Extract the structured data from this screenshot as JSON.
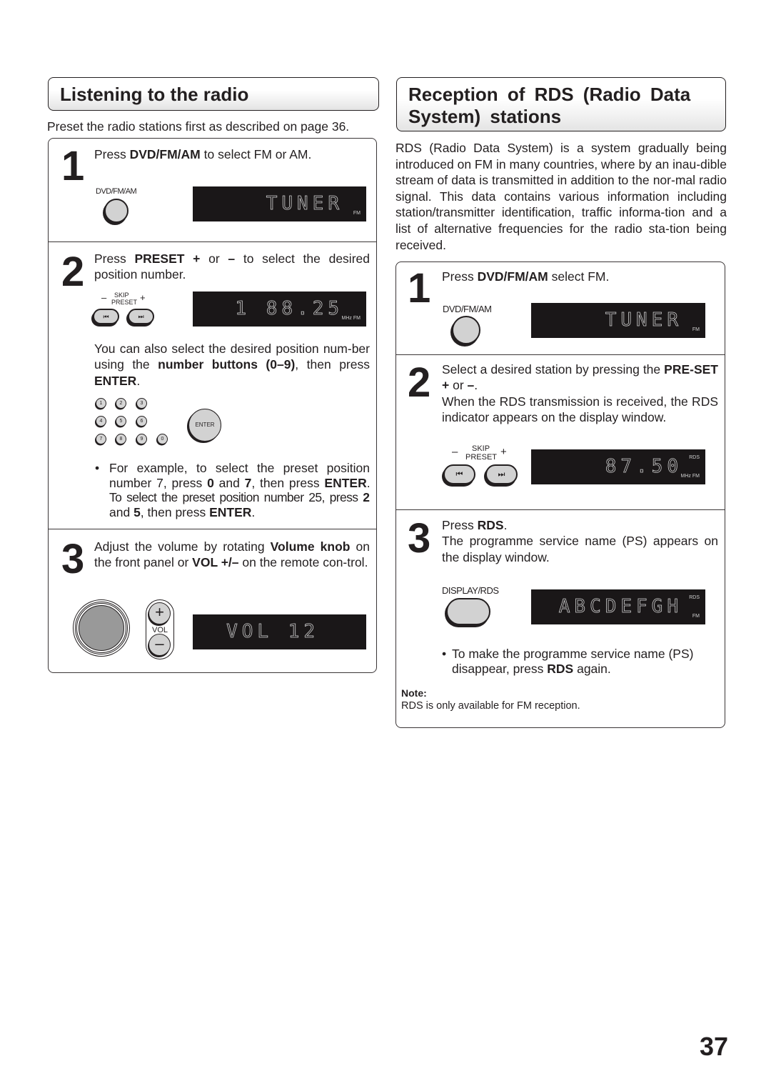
{
  "left_section": {
    "title": "Listening to the radio",
    "intro": "Preset the radio stations first as described on page 36.",
    "step1": {
      "number": "1",
      "text_pre": "Press ",
      "text_bold": "DVD/FM/AM",
      "text_post": " to select FM or AM.",
      "button_label": "DVD/FM/AM",
      "display": {
        "main": "TUNER",
        "indicator": "FM"
      }
    },
    "step2": {
      "number": "2",
      "text_pre": "Press ",
      "text_bold1": "PRESET +",
      "text_mid": " or ",
      "text_bold2": "–",
      "text_post": "  to select the desired position number.",
      "skip_label": "SKIP",
      "preset_label": "PRESET",
      "minus_label": "–",
      "plus_label": "+",
      "prev_glyph": "⏮",
      "next_glyph": "⏭",
      "display": {
        "main": "1 88.25",
        "indicator": "MHz FM"
      },
      "alt_text_pre": "You can also select the desired position num-ber using the ",
      "alt_text_bold": "number buttons (0–9)",
      "alt_text_mid": ", then press ",
      "alt_text_bold2": "ENTER",
      "alt_text_post": ".",
      "number_buttons": [
        "1",
        "2",
        "3",
        "4",
        "5",
        "6",
        "7",
        "8",
        "9",
        "0"
      ],
      "enter_label": "ENTER",
      "bullet": {
        "part1": "For example, to select the preset position number 7, press ",
        "b1": "0",
        "part2": " and ",
        "b2": "7",
        "part3": ", then press ",
        "b3": "ENTER",
        "part4": ". To select the preset position number 25, press ",
        "b4": "2",
        "part5": " and ",
        "b5": "5",
        "part6": ", then press ",
        "b6": "ENTER",
        "part7": "."
      }
    },
    "step3": {
      "number": "3",
      "text_pre": "Adjust the volume by rotating ",
      "text_bold1": "Volume knob",
      "text_mid": " on the front panel or ",
      "text_bold2": "VOL +/–",
      "text_post": " on the remote con-trol.",
      "vol_label": "VOL",
      "plus": "+",
      "minus": "–",
      "display": {
        "main": "VOL 12"
      }
    }
  },
  "right_section": {
    "title": "Reception of RDS (Radio Data System) stations",
    "intro": "RDS (Radio Data System) is a system gradually being introduced on FM in many countries, where by an inau-dible stream of data is transmitted in addition to the nor-mal radio signal. This data contains various information including station/transmitter identification, traffic informa-tion and a list of alternative frequencies for the radio sta-tion being received.",
    "step1": {
      "number": "1",
      "text_pre": "Press ",
      "text_bold": "DVD/FM/AM",
      "text_post": " select FM.",
      "button_label": "DVD/FM/AM",
      "display": {
        "main": "TUNER",
        "indicator": "FM"
      }
    },
    "step2": {
      "number": "2",
      "text_pre": "Select a desired station by pressing the ",
      "text_bold1": "PRE-SET +",
      "text_mid": " or ",
      "text_bold2": "–",
      "text_post": ".",
      "text_line2": "When the RDS transmission is received, the RDS indicator appears on the display window.",
      "skip_label": "SKIP",
      "preset_label": "PRESET",
      "minus_label": "–",
      "plus_label": "+",
      "prev_glyph": "⏮",
      "next_glyph": "⏭",
      "display": {
        "main": "87.50",
        "indicator_top": "RDS",
        "indicator": "MHz FM"
      }
    },
    "step3": {
      "number": "3",
      "text_pre": "Press ",
      "text_bold": "RDS",
      "text_post": ".",
      "text_line2": "The programme service name (PS) appears on the display window.",
      "button_label": "DISPLAY/RDS",
      "display": {
        "main": "ABCDEFGH",
        "indicator_top": "RDS",
        "indicator": "FM"
      },
      "bullet_pre": "To make the programme service name (PS) disappear, press ",
      "bullet_bold": "RDS",
      "bullet_post": " again."
    },
    "note_title": "Note:",
    "note_text": "RDS is only available for FM reception."
  },
  "page_number": "37",
  "bullet_char": "•"
}
